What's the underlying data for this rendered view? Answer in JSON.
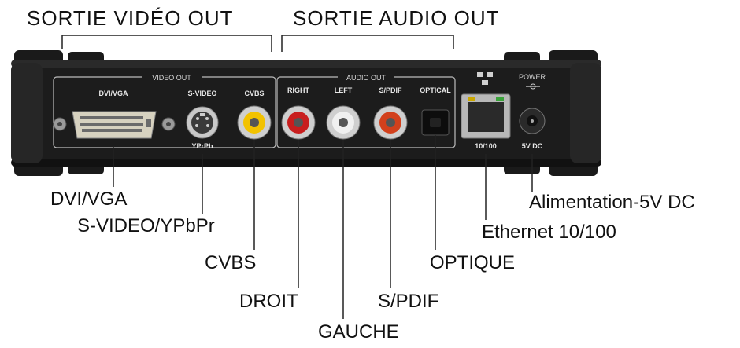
{
  "sections": {
    "video_out": "SORTIE VIDÉO OUT",
    "audio_out": "SORTIE AUDIO OUT"
  },
  "panel": {
    "video_out": "VIDEO OUT",
    "audio_out": "AUDIO OUT",
    "dvi_vga": "DVI/VGA",
    "s_video": "S-VIDEO",
    "yprpb": "YPrPb",
    "cvbs": "CVBS",
    "right": "RIGHT",
    "left": "LEFT",
    "spdif": "S/PDIF",
    "optical": "OPTICAL",
    "eth": "10/100",
    "power": "POWER",
    "dc": "5V DC"
  },
  "callouts": {
    "dvi_vga": "DVI/VGA",
    "s_video": "S-VIDEO/YPbPr",
    "cvbs": "CVBS",
    "droit": "DROIT",
    "gauche": "GAUCHE",
    "spdif": "S/PDIF",
    "optique": "OPTIQUE",
    "ethernet": "Ethernet 10/100",
    "power": "Alimentation-5V DC"
  },
  "colors": {
    "device_body": "#1c1c1c",
    "rca_yellow": "#f2c200",
    "rca_red": "#c81e1e",
    "rca_white": "#f0f0f0",
    "rca_orange": "#d2401c"
  }
}
